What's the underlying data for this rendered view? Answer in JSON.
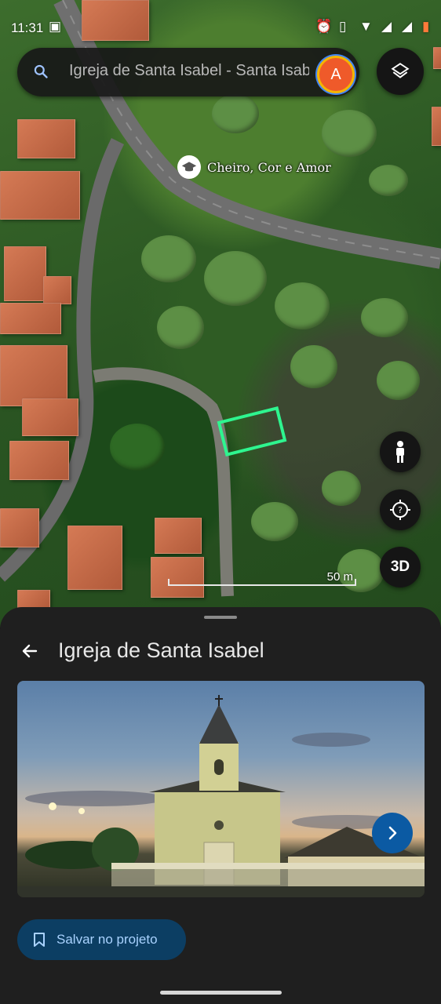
{
  "status_bar": {
    "time": "11:31",
    "icons": [
      "clipboard-icon",
      "alarm-icon",
      "vibrate-icon",
      "wifi-icon",
      "signal-icon",
      "signal-icon",
      "battery-icon"
    ]
  },
  "search": {
    "query": "Igreja de Santa Isabel - Santa Isabel",
    "avatar_letter": "A"
  },
  "map": {
    "poi_label": "Cheiro, Cor e Amor",
    "scale_label": "50 m",
    "btn_3d": "3D",
    "selection_color": "#2ef58f"
  },
  "sheet": {
    "title": "Igreja de Santa Isabel",
    "save_label": "Salvar no projeto"
  },
  "colors": {
    "sheet_bg": "#1f1f1f",
    "save_bg": "#0c3e63",
    "save_text": "#a9d2ff",
    "next_btn": "#0b5aa3"
  }
}
